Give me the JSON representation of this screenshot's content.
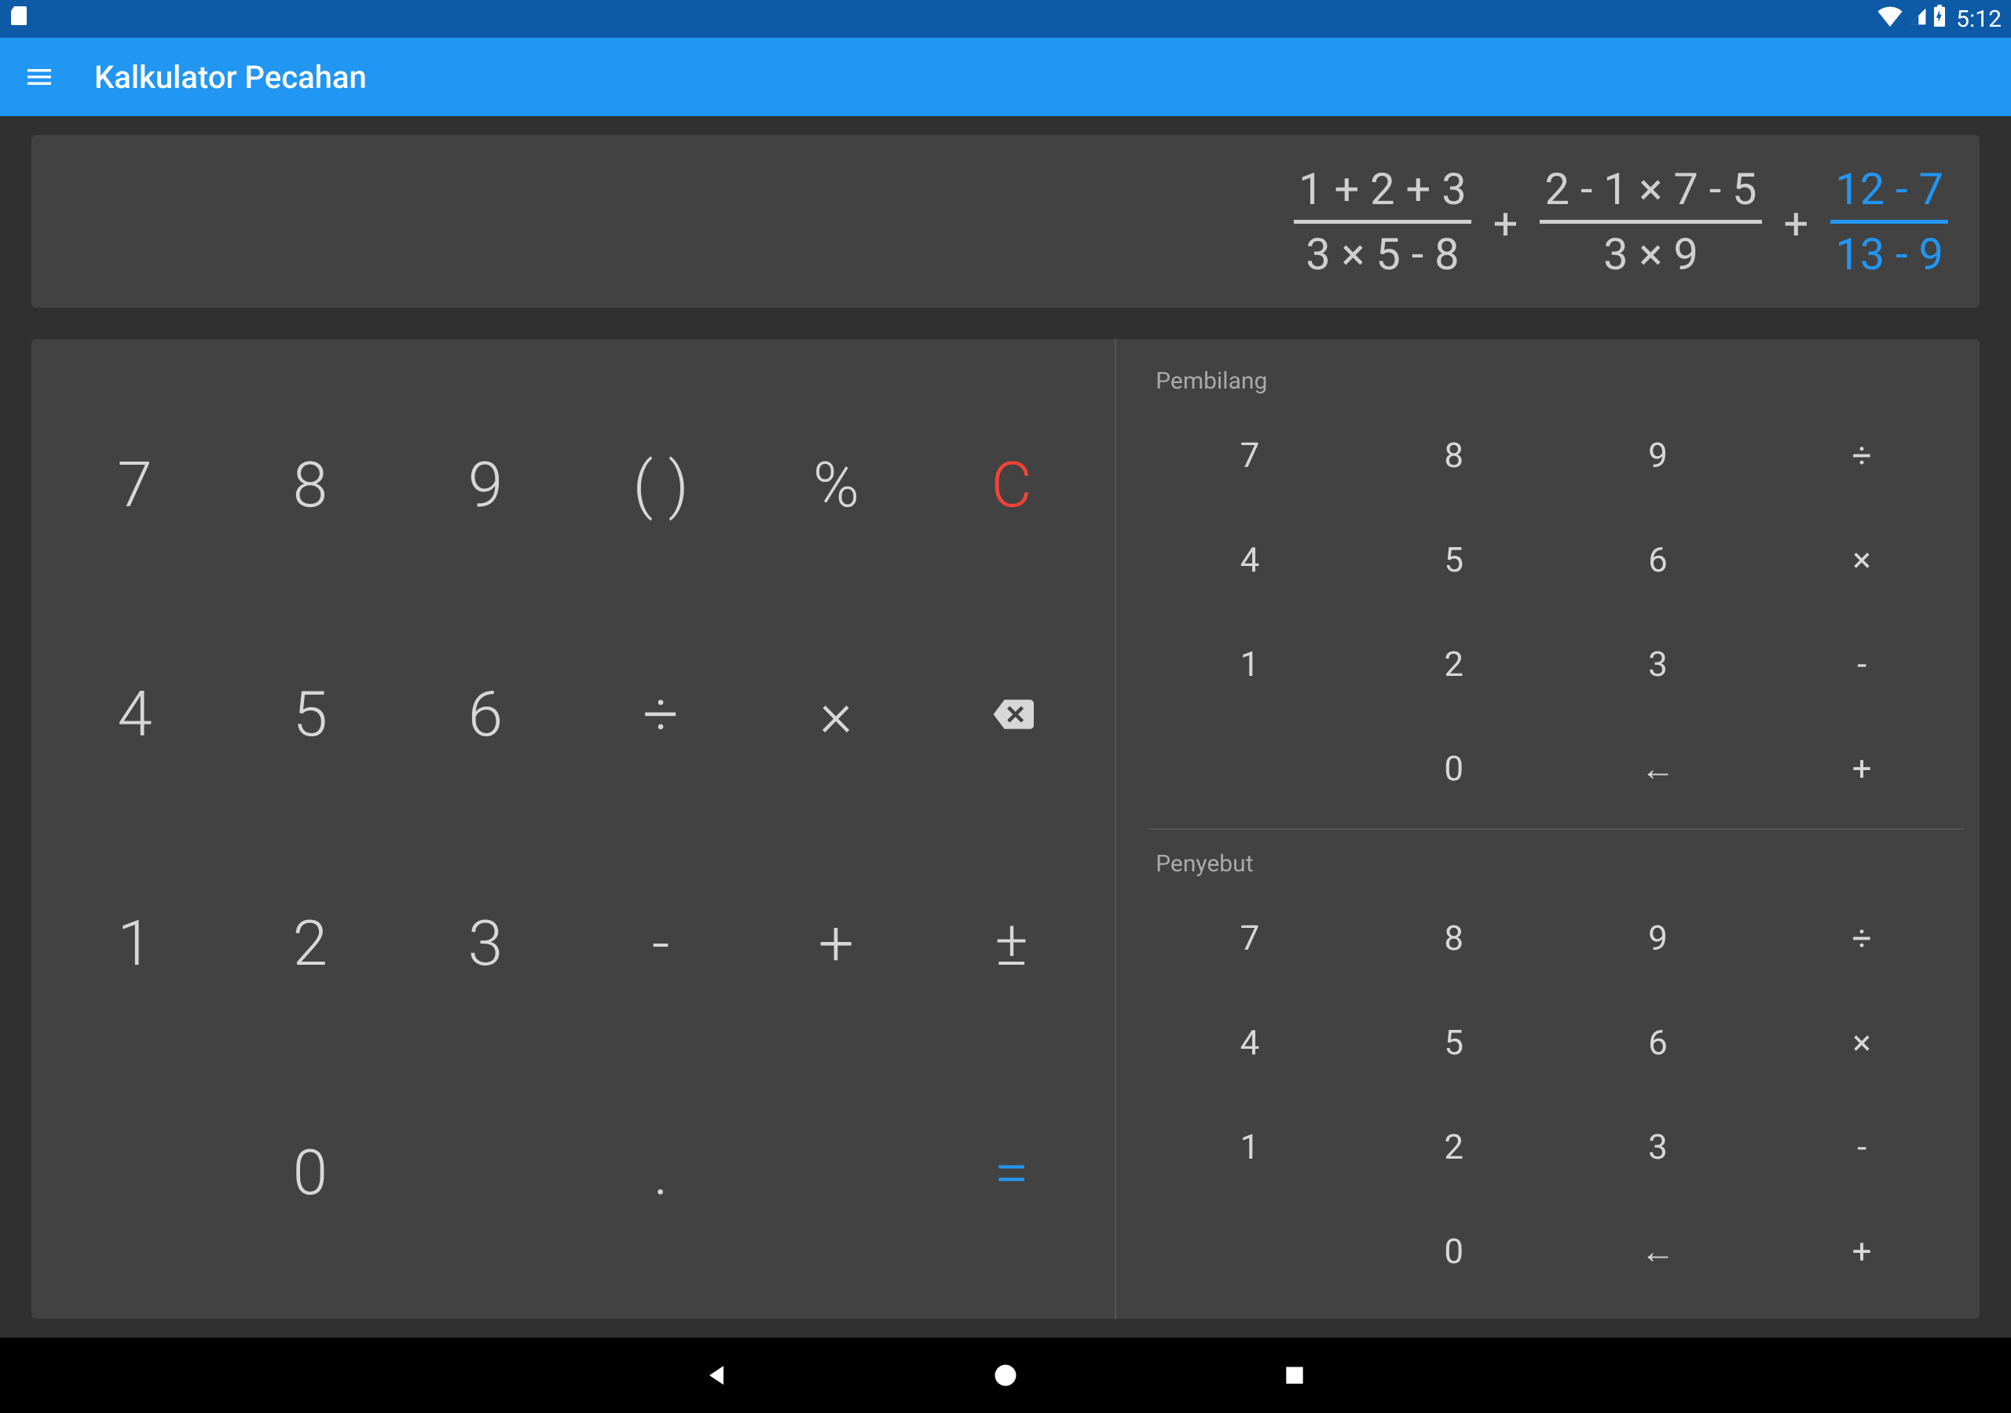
{
  "status": {
    "time": "5:12"
  },
  "app": {
    "title": "Kalkulator Pecahan"
  },
  "expression": {
    "terms": [
      {
        "numerator": "1 + 2 + 3",
        "denominator": "3 × 5 - 8",
        "active": false
      },
      {
        "numerator": "2 - 1 × 7 - 5",
        "denominator": "3 × 9",
        "active": false
      },
      {
        "numerator": "12 - 7",
        "denominator": "13 - 9",
        "active": true
      }
    ],
    "operators": [
      "+",
      "+"
    ]
  },
  "leftKeypad": [
    [
      "7",
      "8",
      "9",
      "( )",
      "%",
      "C"
    ],
    [
      "4",
      "5",
      "6",
      "÷",
      "×",
      "⌫"
    ],
    [
      "1",
      "2",
      "3",
      "-",
      "+",
      "±"
    ],
    [
      "",
      "0",
      "",
      ".",
      "",
      "="
    ]
  ],
  "rightPads": {
    "numerator": {
      "label": "Pembilang",
      "rows": [
        [
          "7",
          "8",
          "9",
          "÷"
        ],
        [
          "4",
          "5",
          "6",
          "×"
        ],
        [
          "1",
          "2",
          "3",
          "-"
        ],
        [
          "",
          "0",
          "←",
          "+"
        ]
      ]
    },
    "denominator": {
      "label": "Penyebut",
      "rows": [
        [
          "7",
          "8",
          "9",
          "÷"
        ],
        [
          "4",
          "5",
          "6",
          "×"
        ],
        [
          "1",
          "2",
          "3",
          "-"
        ],
        [
          "",
          "0",
          "←",
          "+"
        ]
      ]
    }
  }
}
